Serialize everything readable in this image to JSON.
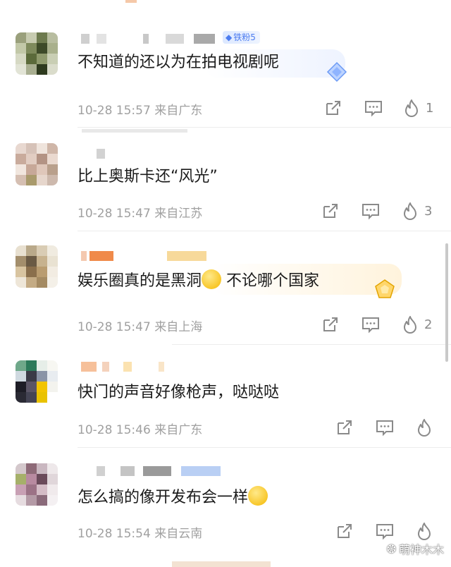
{
  "comments": [
    {
      "text": "不知道的还以为在拍电视剧呢",
      "time": "10-28 15:57",
      "location": "来自广东",
      "likes": "1",
      "badge": "铁粉5"
    },
    {
      "text": "比上奥斯卡还“风光”",
      "time": "10-28 15:47",
      "location": "来自江苏",
      "likes": "3"
    },
    {
      "text_before": "娱乐圈真的是黑洞",
      "text_after": " 不论哪个国家",
      "time": "10-28 15:47",
      "location": "来自上海",
      "likes": "2"
    },
    {
      "text": "快门的声音好像枪声，哒哒哒",
      "time": "10-28 15:46",
      "location": "来自广东",
      "likes": ""
    },
    {
      "text": "怎么搞的像开发布会一样",
      "time": "10-28 15:54",
      "location": "来自云南",
      "likes": ""
    }
  ],
  "icons": {
    "share": "share-icon",
    "comment": "comment-icon",
    "like": "flame-like-icon"
  },
  "watermark": {
    "text": "萌神木木"
  },
  "colors": {
    "text": "#1a1a1a",
    "meta": "#a0a0a0",
    "badge": "#4c7cf0"
  }
}
